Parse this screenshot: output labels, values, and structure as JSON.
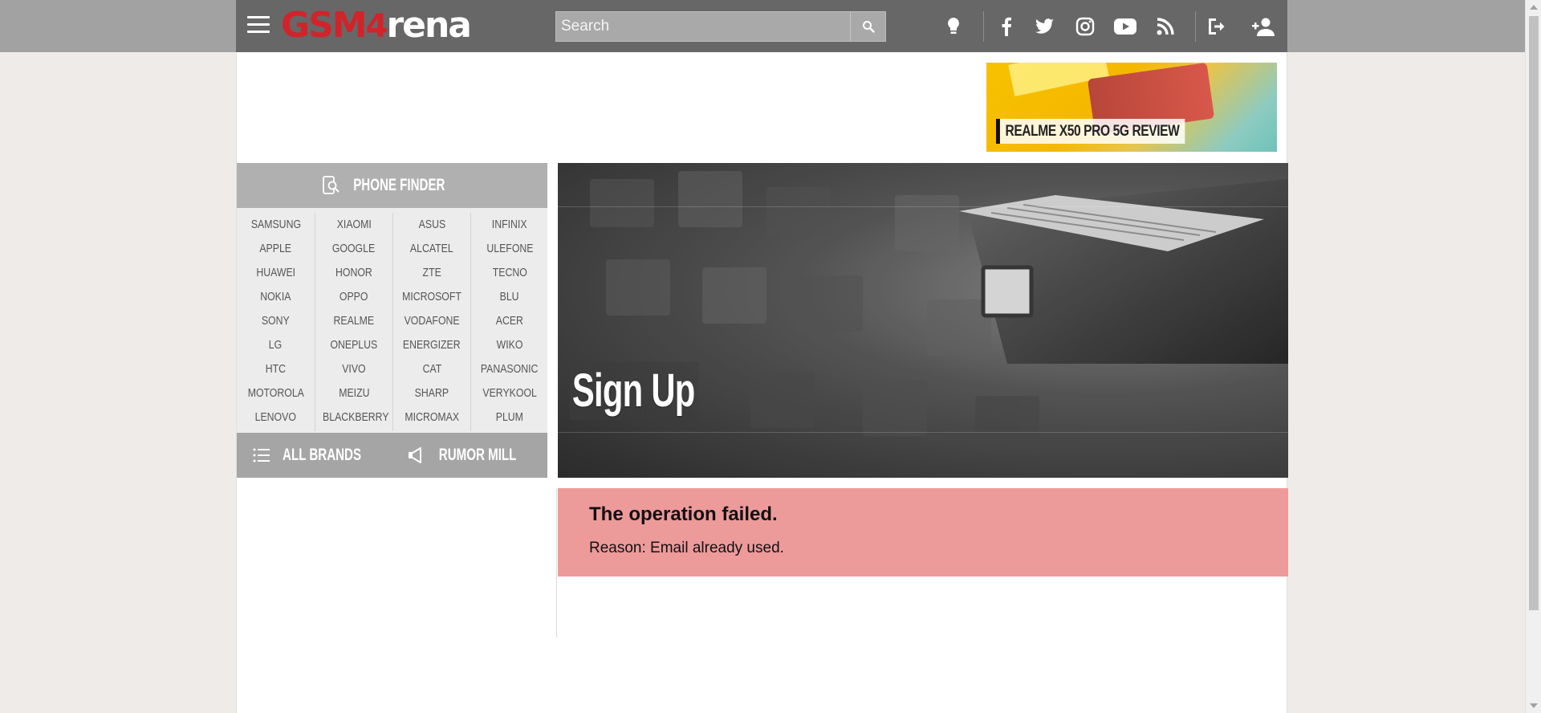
{
  "header": {
    "logo": {
      "part1": "GSM",
      "part2": "4",
      "part3": "rena"
    },
    "search": {
      "placeholder": "Search",
      "value": ""
    },
    "icons": [
      "tip-icon",
      "facebook-icon",
      "twitter-icon",
      "instagram-icon",
      "youtube-icon",
      "rss-icon",
      "login-icon",
      "add-user-icon"
    ]
  },
  "ad": {
    "label": "REALME X50 PRO 5G REVIEW"
  },
  "sidebar": {
    "phone_finder": "PHONE FINDER",
    "brands": [
      [
        "SAMSUNG",
        "APPLE",
        "HUAWEI",
        "NOKIA",
        "SONY",
        "LG",
        "HTC",
        "MOTOROLA",
        "LENOVO"
      ],
      [
        "XIAOMI",
        "GOOGLE",
        "HONOR",
        "OPPO",
        "REALME",
        "ONEPLUS",
        "VIVO",
        "MEIZU",
        "BLACKBERRY"
      ],
      [
        "ASUS",
        "ALCATEL",
        "ZTE",
        "MICROSOFT",
        "VODAFONE",
        "ENERGIZER",
        "CAT",
        "SHARP",
        "MICROMAX"
      ],
      [
        "INFINIX",
        "ULEFONE",
        "TECNO",
        "BLU",
        "ACER",
        "WIKO",
        "PANASONIC",
        "VERYKOOL",
        "PLUM"
      ]
    ],
    "all_brands": "ALL BRANDS",
    "rumor_mill": "RUMOR MILL"
  },
  "hero": {
    "title": "Sign Up"
  },
  "error": {
    "title": "The operation failed.",
    "reason": "Reason: Email already used."
  },
  "colors": {
    "header_bg": "#676767",
    "logo_red": "#d2232a",
    "error_bg": "#ed9a9b"
  }
}
